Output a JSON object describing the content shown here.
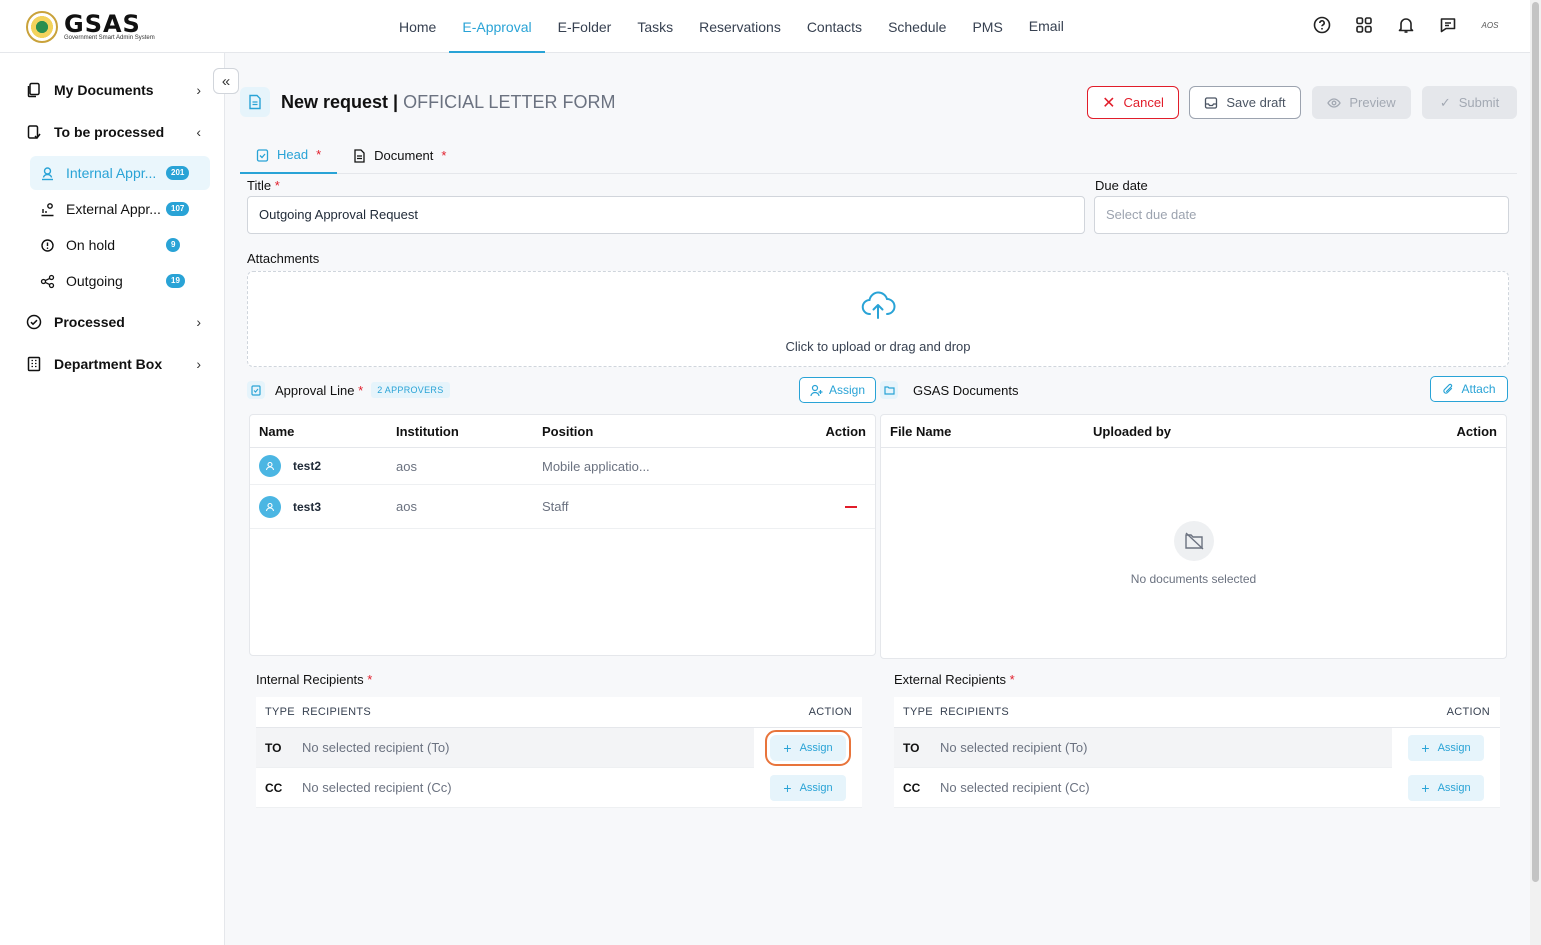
{
  "logo": {
    "name": "GSAS",
    "subtitle": "Government Smart Admin System"
  },
  "nav": [
    "Home",
    "E-Approval",
    "E-Folder",
    "Tasks",
    "Reservations",
    "Contacts",
    "Schedule",
    "PMS",
    "Email"
  ],
  "nav_active": "E-Approval",
  "top_icons": [
    "help-icon",
    "apps-grid-icon",
    "bell-icon",
    "chat-icon"
  ],
  "user_initials": "AOS",
  "sidebar": {
    "my_documents": "My Documents",
    "to_be_processed": "To be processed",
    "items": [
      {
        "label": "Internal Appr...",
        "count": "201",
        "icon": "user-icon"
      },
      {
        "label": "External Appr...",
        "count": "107",
        "icon": "external-icon"
      },
      {
        "label": "On hold",
        "count": "9",
        "icon": "alert-circle-icon"
      },
      {
        "label": "Outgoing",
        "count": "19",
        "icon": "share-icon"
      }
    ],
    "processed": "Processed",
    "department_box": "Department Box"
  },
  "page": {
    "title": "New request |",
    "form": "OFFICIAL LETTER FORM"
  },
  "actions": {
    "cancel": "Cancel",
    "save_draft": "Save draft",
    "preview": "Preview",
    "submit": "Submit"
  },
  "tabs": [
    {
      "label": "Head"
    },
    {
      "label": "Document"
    }
  ],
  "required_mark": "*",
  "form": {
    "title_label": "Title",
    "title_value": "Outgoing Approval Request",
    "due_label": "Due date",
    "due_placeholder": "Select due date",
    "attachments_label": "Attachments",
    "upload_text": "Click to upload or drag and drop"
  },
  "approval": {
    "title": "Approval Line",
    "count_tag": "2 APPROVERS",
    "assign": "Assign",
    "columns": [
      "Name",
      "Institution",
      "Position",
      "Action"
    ],
    "rows": [
      {
        "name": "test2",
        "institution": "aos",
        "position": "Mobile applicatio..."
      },
      {
        "name": "test3",
        "institution": "aos",
        "position": "Staff"
      }
    ]
  },
  "gsas_docs": {
    "title": "GSAS Documents",
    "attach": "Attach",
    "columns": [
      "File Name",
      "Uploaded by",
      "Action"
    ],
    "empty": "No documents selected"
  },
  "internal": {
    "title": "Internal Recipients",
    "columns": [
      "TYPE",
      "RECIPIENTS",
      "ACTION"
    ],
    "rows": [
      {
        "type": "TO",
        "text": "No selected recipient (To)",
        "action": "Assign"
      },
      {
        "type": "CC",
        "text": "No selected recipient (Cc)",
        "action": "Assign"
      }
    ]
  },
  "external": {
    "title": "External Recipients",
    "columns": [
      "TYPE",
      "RECIPIENTS",
      "ACTION"
    ],
    "rows": [
      {
        "type": "TO",
        "text": "No selected recipient (To)",
        "action": "Assign"
      },
      {
        "type": "CC",
        "text": "No selected recipient (Cc)",
        "action": "Assign"
      }
    ]
  },
  "colors": {
    "accent": "#29a3d6",
    "danger": "#e11d2a",
    "highlight": "#e8743b"
  }
}
